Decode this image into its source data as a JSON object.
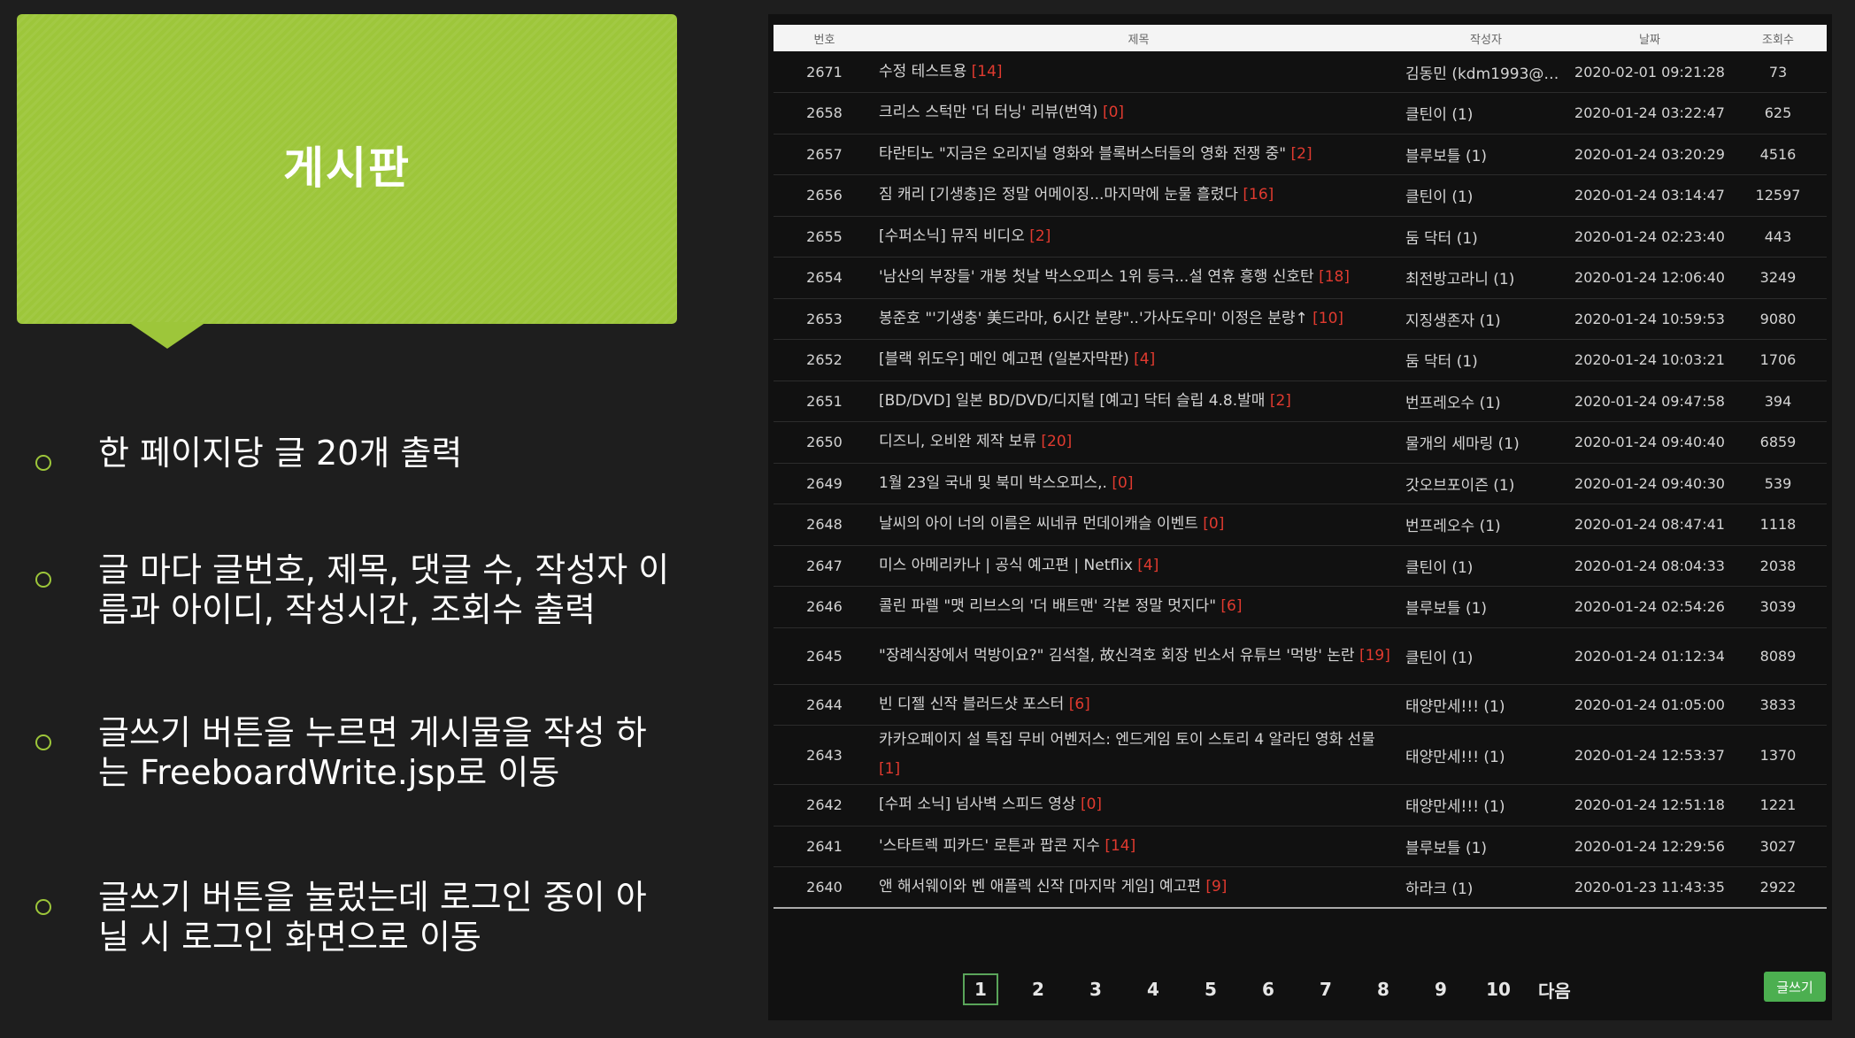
{
  "slide": {
    "title": "게시판",
    "bullets": [
      {
        "text": "한 페이지당 글 20개 출력"
      },
      {
        "text": "글 마다 글번호, 제목, 댓글 수, 작성자 이름과 아이디, 작성시간, 조회수 출력"
      },
      {
        "text": "글쓰기 버튼을 누르면 게시물을 작성 하는 FreeboardWrite.jsp로 이동"
      },
      {
        "text": "글쓰기 버튼을 눌렀는데 로그인 중이 아닐 시 로그인 화면으로 이동"
      }
    ],
    "accent_color": "#9dc63a"
  },
  "board": {
    "headers": {
      "no": "번호",
      "title": "제목",
      "writer": "작성자",
      "date": "날짜",
      "views": "조회수"
    },
    "rows": [
      {
        "no": "2671",
        "title": "수정 테스트용",
        "comments": "[14]",
        "writer": "김동민 (kdm1993@n...",
        "date": "2020-02-01 09:21:28",
        "views": "73"
      },
      {
        "no": "2658",
        "title": "크리스 스턱만 '더 터닝' 리뷰(번역)",
        "comments": "[0]",
        "writer": "클틴이 (1)",
        "date": "2020-01-24 03:22:47",
        "views": "625"
      },
      {
        "no": "2657",
        "title": "타란티노 \"지금은 오리지널 영화와 블록버스터들의 영화 전쟁 중\"",
        "comments": "[2]",
        "writer": "블루보틀 (1)",
        "date": "2020-01-24 03:20:29",
        "views": "4516"
      },
      {
        "no": "2656",
        "title": "짐 캐리 [기생충]은 정말 어메이징...마지막에 눈물 흘렸다",
        "comments": "[16]",
        "writer": "클틴이 (1)",
        "date": "2020-01-24 03:14:47",
        "views": "12597"
      },
      {
        "no": "2655",
        "title": "[수퍼소닉] 뮤직 비디오",
        "comments": "[2]",
        "writer": "둠 닥터 (1)",
        "date": "2020-01-24 02:23:40",
        "views": "443"
      },
      {
        "no": "2654",
        "title": "'남산의 부장들' 개봉 첫날 박스오피스 1위 등극...설 연휴 흥행 신호탄",
        "comments": "[18]",
        "writer": "최전방고라니 (1)",
        "date": "2020-01-24 12:06:40",
        "views": "3249"
      },
      {
        "no": "2653",
        "title": "봉준호 \"'기생충' 美드라마, 6시간 분량\"..'가사도우미' 이정은 분량↑",
        "comments": "[10]",
        "writer": "지징생존자 (1)",
        "date": "2020-01-24 10:59:53",
        "views": "9080"
      },
      {
        "no": "2652",
        "title": "[블랙 위도우] 메인 예고편 (일본자막판)",
        "comments": "[4]",
        "writer": "둠 닥터 (1)",
        "date": "2020-01-24 10:03:21",
        "views": "1706"
      },
      {
        "no": "2651",
        "title": "[BD/DVD] 일본 BD/DVD/디지털 [예고] 닥터 슬립 4.8.발매",
        "comments": "[2]",
        "writer": "번프레오수 (1)",
        "date": "2020-01-24 09:47:58",
        "views": "394"
      },
      {
        "no": "2650",
        "title": "디즈니, 오비완 제작 보류",
        "comments": "[20]",
        "writer": "물개의 세마링 (1)",
        "date": "2020-01-24 09:40:40",
        "views": "6859"
      },
      {
        "no": "2649",
        "title": "1월 23일 국내 및 북미 박스오피스,.",
        "comments": "[0]",
        "writer": "갓오브포이즌 (1)",
        "date": "2020-01-24 09:40:30",
        "views": "539"
      },
      {
        "no": "2648",
        "title": "날씨의 아이 너의 이름은 씨네큐 먼데이캐슬 이벤트",
        "comments": "[0]",
        "writer": "번프레오수 (1)",
        "date": "2020-01-24 08:47:41",
        "views": "1118"
      },
      {
        "no": "2647",
        "title": "미스 아메리카나 | 공식 예고편 | Netflix",
        "comments": "[4]",
        "writer": "클틴이 (1)",
        "date": "2020-01-24 08:04:33",
        "views": "2038"
      },
      {
        "no": "2646",
        "title": "콜린 파렐 \"맷 리브스의 '더 배트맨' 각본 정말 멋지다\"",
        "comments": "[6]",
        "writer": "블루보틀 (1)",
        "date": "2020-01-24 02:54:26",
        "views": "3039"
      },
      {
        "no": "2645",
        "title": "\"장례식장에서 먹방이요?\" 김석철, 故신격호 회장 빈소서 유튜브 '먹방' 논란",
        "comments": "[19]",
        "writer": "클틴이 (1)",
        "date": "2020-01-24 01:12:34",
        "views": "8089",
        "tall": true
      },
      {
        "no": "2644",
        "title": "빈 디젤 신작 블러드샷 포스터",
        "comments": "[6]",
        "writer": "태양만세!!! (1)",
        "date": "2020-01-24 01:05:00",
        "views": "3833"
      },
      {
        "no": "2643",
        "title": "카카오페이지 설 특집 무비 어벤저스: 엔드게임 토이 스토리 4 알라딘 영화 선물",
        "comments": "[1]",
        "writer": "태양만세!!! (1)",
        "date": "2020-01-24 12:53:37",
        "views": "1370",
        "tall": true
      },
      {
        "no": "2642",
        "title": "[수퍼 소닉] 넘사벽 스피드 영상",
        "comments": "[0]",
        "writer": "태양만세!!! (1)",
        "date": "2020-01-24 12:51:18",
        "views": "1221"
      },
      {
        "no": "2641",
        "title": "'스타트렉 피카드' 로튼과 팝콘 지수",
        "comments": "[14]",
        "writer": "블루보틀 (1)",
        "date": "2020-01-24 12:29:56",
        "views": "3027"
      },
      {
        "no": "2640",
        "title": "앤 해서웨이와 벤 애플렉 신작 [마지막 게임] 예고편",
        "comments": "[9]",
        "writer": "하라크 (1)",
        "date": "2020-01-23 11:43:35",
        "views": "2922"
      }
    ],
    "pagination": {
      "pages": [
        "1",
        "2",
        "3",
        "4",
        "5",
        "6",
        "7",
        "8",
        "9",
        "10"
      ],
      "active": "1",
      "next_label": "다음"
    },
    "write_button": "글쓰기",
    "comment_color": "#e03a2f"
  }
}
